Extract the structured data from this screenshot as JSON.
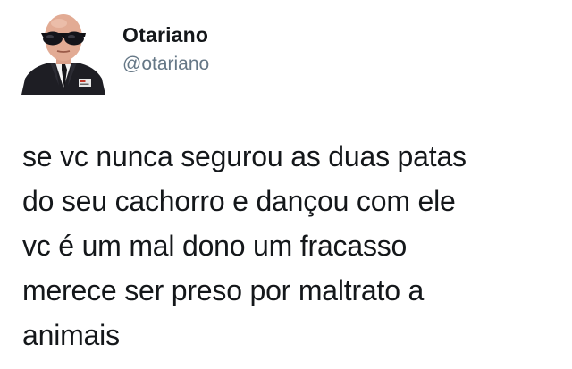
{
  "tweet": {
    "author": {
      "display_name": "Otariano",
      "handle": "@otariano"
    },
    "text_lines": [
      "se vc nunca segurou as duas patas",
      "do seu cachorro e dançou com ele",
      "vc é um mal dono um fracasso",
      "merece ser preso por maltrato a",
      "animais"
    ]
  },
  "colors": {
    "name": "#14171a",
    "handle": "#657786",
    "text": "#14171a",
    "background": "#ffffff"
  }
}
